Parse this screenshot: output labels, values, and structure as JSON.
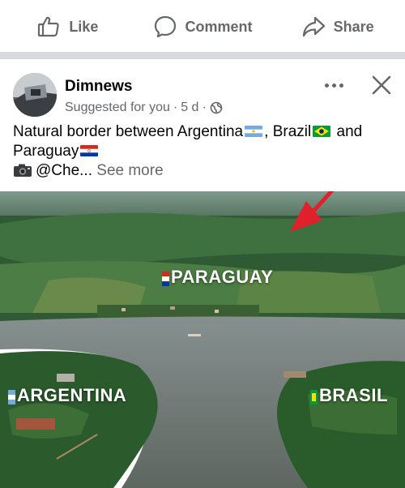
{
  "action_bar": {
    "like_label": "Like",
    "comment_label": "Comment",
    "share_label": "Share"
  },
  "post": {
    "page_name": "Dimnews",
    "suggested_label": "Suggested for you",
    "separator": "·",
    "time_ago": "5 d",
    "visibility_icon": "globe-icon",
    "caption": {
      "line1_a": "Natural border between Argentina",
      "line1_b": ", Brazil",
      "line1_c": " and",
      "line2": "Paraguay",
      "line3_handle": "@Che...",
      "see_more_label": "See more"
    }
  },
  "photo": {
    "labels": {
      "paraguay": "PARAGUAY",
      "argentina": "ARGENTINA",
      "brasil": "BRASIL"
    }
  },
  "colors": {
    "secondary_text": "#65676b",
    "primary_text": "#050505",
    "divider": "#d9dadd",
    "arrow": "#e0202a"
  }
}
